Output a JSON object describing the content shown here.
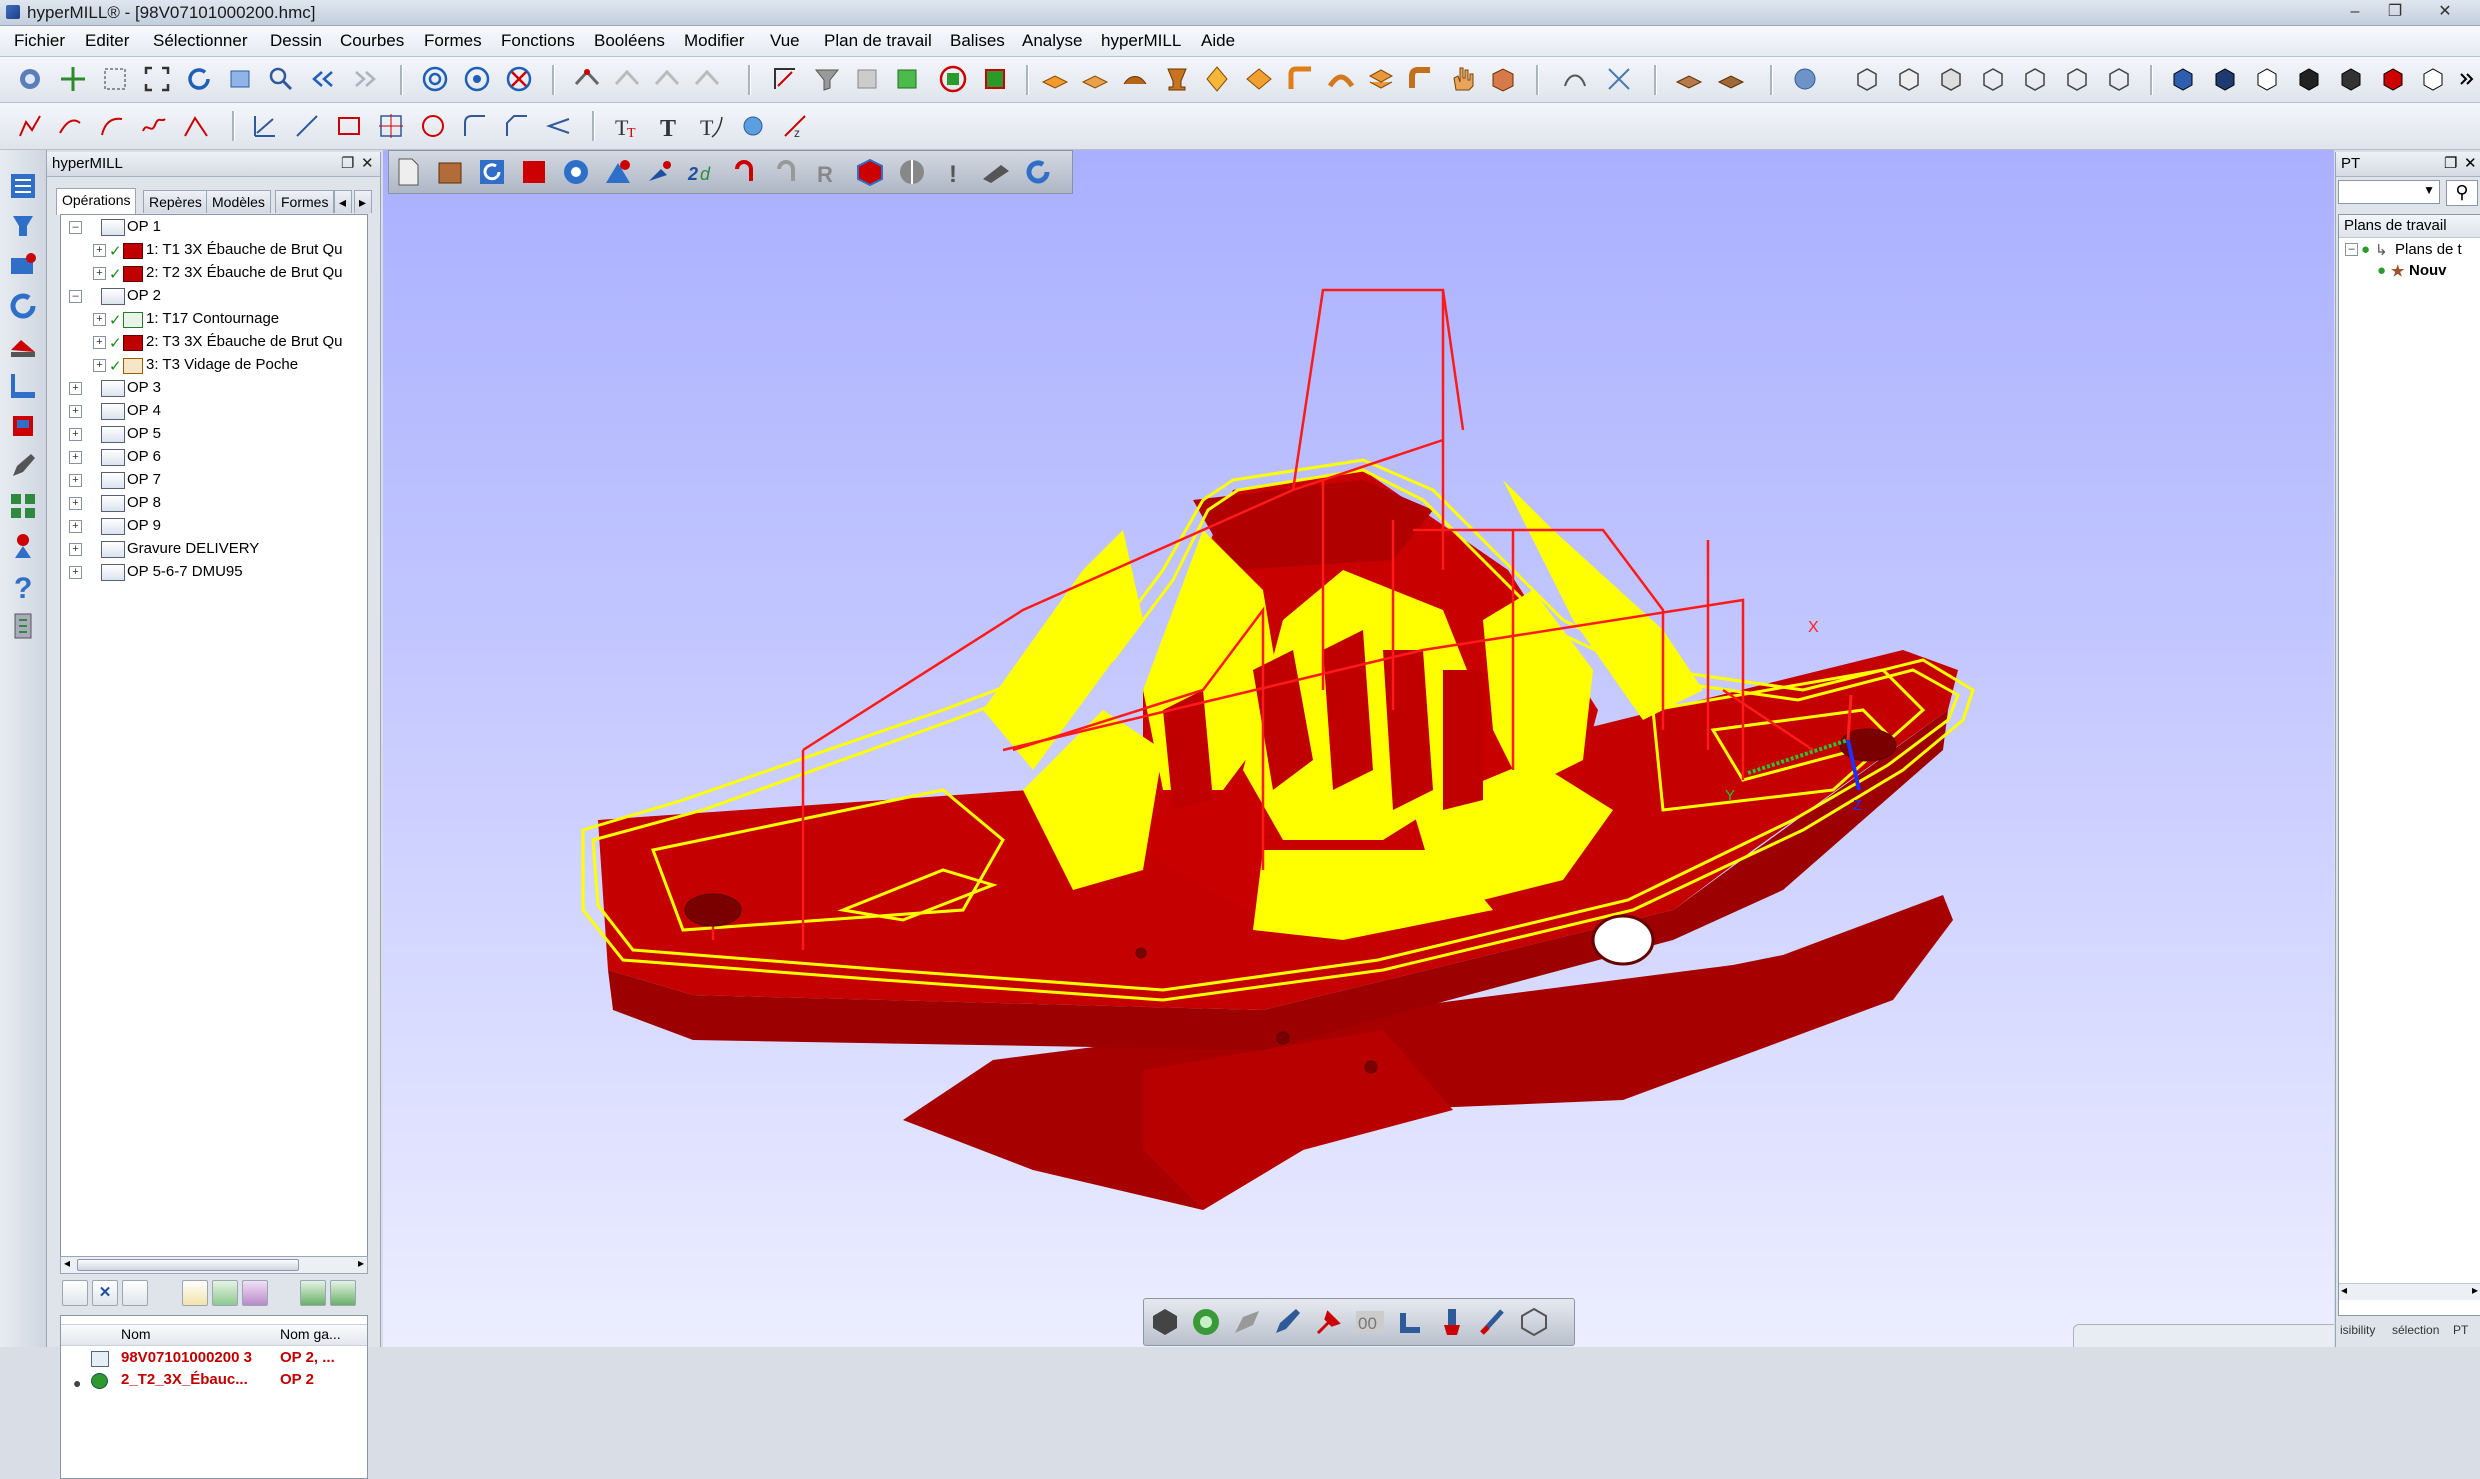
{
  "window": {
    "title": "hyperMILL® - [98V07101000200.hmc]"
  },
  "menu": [
    "Fichier",
    "Editer",
    "Sélectionner",
    "Dessin",
    "Courbes",
    "Formes",
    "Fonctions",
    "Booléens",
    "Modifier",
    "Vue",
    "Plan de travail",
    "Balises",
    "Analyse",
    "hyperMILL",
    "Aide"
  ],
  "left_panel": {
    "title": "hyperMILL",
    "tabs": [
      "Opérations",
      "Repères",
      "Modèles",
      "Formes"
    ],
    "tree": [
      {
        "label": "OP 1",
        "level": 0,
        "expanded": true
      },
      {
        "label": "1: T1 3X Ébauche de Brut Qu",
        "level": 1
      },
      {
        "label": "2: T2 3X Ébauche de Brut Qu",
        "level": 1
      },
      {
        "label": "OP 2",
        "level": 0,
        "expanded": true
      },
      {
        "label": "1: T17 Contournage",
        "level": 1
      },
      {
        "label": "2: T3 3X Ébauche de Brut Qu",
        "level": 1
      },
      {
        "label": "3: T3 Vidage de Poche",
        "level": 1
      },
      {
        "label": "OP 3",
        "level": 0
      },
      {
        "label": "OP 4",
        "level": 0
      },
      {
        "label": "OP 5",
        "level": 0
      },
      {
        "label": "OP 6",
        "level": 0
      },
      {
        "label": "OP 7",
        "level": 0
      },
      {
        "label": "OP 8",
        "level": 0
      },
      {
        "label": "OP 9",
        "level": 0
      },
      {
        "label": "Gravure DELIVERY",
        "level": 0
      },
      {
        "label": "OP 5-6-7 DMU95",
        "level": 0
      }
    ],
    "list": {
      "columns": [
        "Nom",
        "Nom ga..."
      ],
      "rows": [
        {
          "name": "98V07101000200 3",
          "group": "OP 2, ..."
        },
        {
          "name": "2_T2_3X_Ébauc...",
          "group": "OP 2"
        }
      ]
    }
  },
  "right_panel": {
    "title": "PT",
    "header": "Plans de travail",
    "items": [
      "Plans de t",
      "Nouv"
    ],
    "tabs": [
      "isibility",
      "sélection",
      "PT"
    ]
  },
  "viewport": {
    "axis_labels": {
      "x": "X",
      "y": "Y",
      "z": "Z"
    },
    "colors": {
      "part": "#c00000",
      "toolpath": "#ffff00",
      "edge": "#ff2020"
    }
  }
}
